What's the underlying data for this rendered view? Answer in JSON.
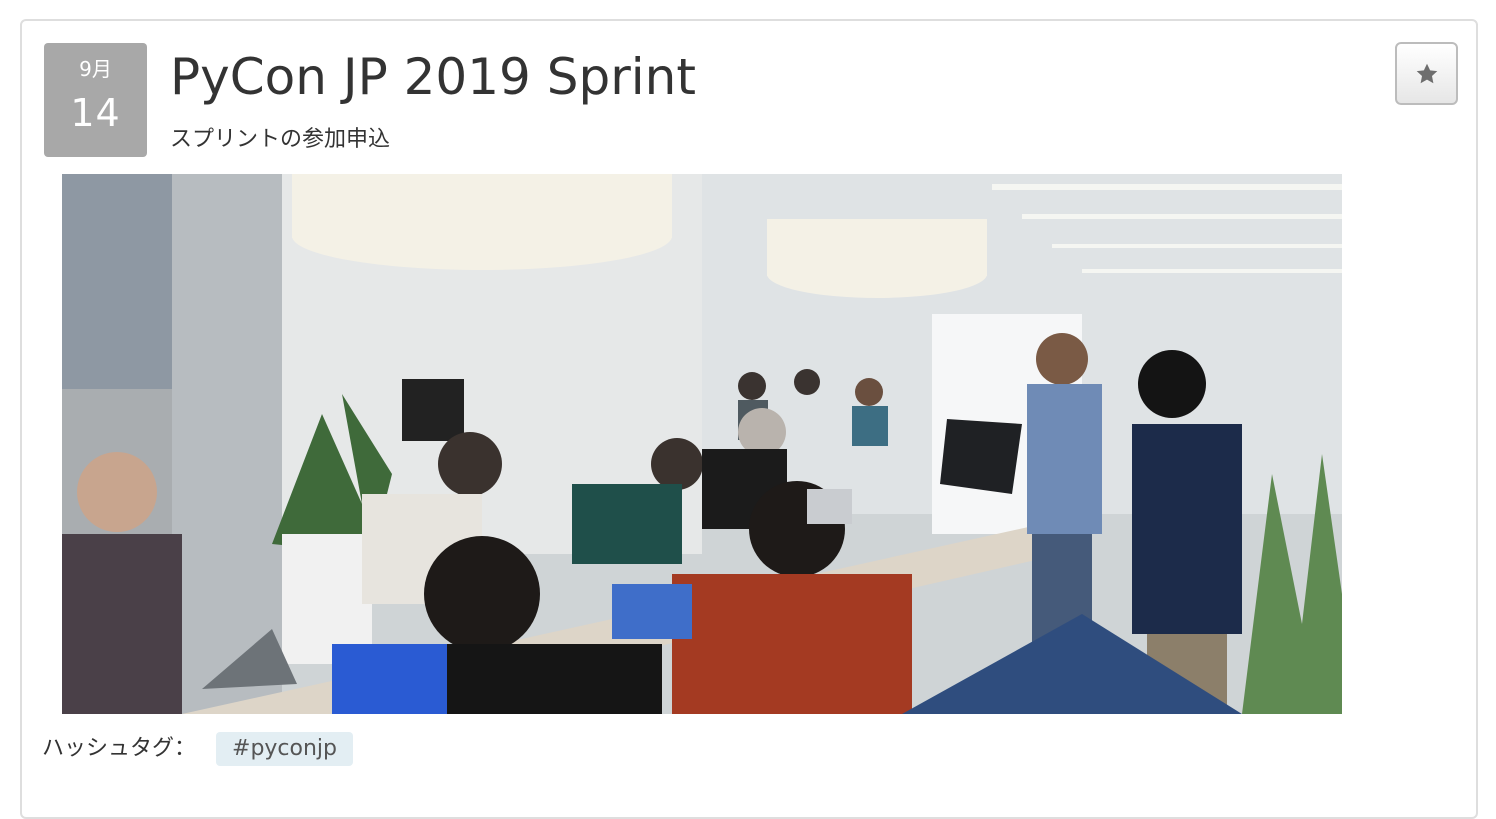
{
  "event": {
    "date": {
      "month": "9月",
      "day": "14"
    },
    "title": "PyCon JP 2019 Sprint",
    "subtitle": "スプリントの参加申込",
    "star_button": {
      "icon": "star-icon"
    },
    "image": {
      "alt": "Sprint participants working on laptops at a long table in an office while a presenter shows a laptop"
    },
    "hashtag": {
      "label": "ハッシュタグ：",
      "tag": "#pyconjp"
    }
  },
  "colors": {
    "date_badge_bg": "#a8a8a8",
    "hashtag_chip_bg": "#e3eef3",
    "card_border": "#dedede"
  }
}
